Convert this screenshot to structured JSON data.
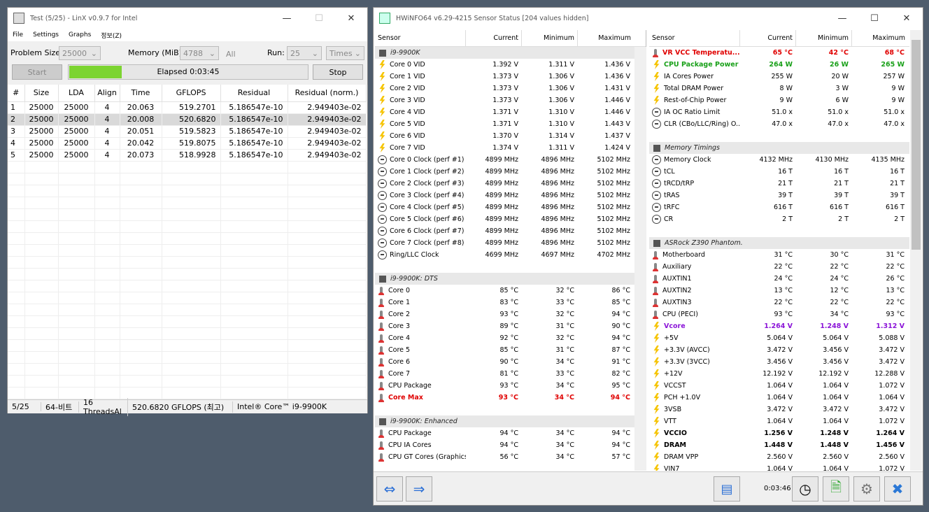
{
  "linx": {
    "title": "Test (5/25) - LinX v0.9.7 for Intel",
    "menu": [
      "File",
      "Settings",
      "Graphs",
      "정보(Z)"
    ],
    "problem_size_label": "Problem Size:",
    "problem_size": "25000",
    "memory_label": "Memory (MiB):",
    "memory": "4788",
    "all_label": "All",
    "run_label": "Run:",
    "run": "25",
    "run_mode": "Times",
    "start": "Start",
    "stop": "Stop",
    "elapsed": "Elapsed 0:03:45",
    "progress": 0.22,
    "columns": [
      "#",
      "Size",
      "LDA",
      "Align",
      "Time",
      "GFLOPS",
      "Residual",
      "Residual (norm.)"
    ],
    "rows": [
      [
        "1",
        "25000",
        "25000",
        "4",
        "20.063",
        "519.2701",
        "5.186547e-10",
        "2.949403e-02"
      ],
      [
        "2",
        "25000",
        "25000",
        "4",
        "20.008",
        "520.6820",
        "5.186547e-10",
        "2.949403e-02"
      ],
      [
        "3",
        "25000",
        "25000",
        "4",
        "20.051",
        "519.5823",
        "5.186547e-10",
        "2.949403e-02"
      ],
      [
        "4",
        "25000",
        "25000",
        "4",
        "20.042",
        "519.8075",
        "5.186547e-10",
        "2.949403e-02"
      ],
      [
        "5",
        "25000",
        "25000",
        "4",
        "20.073",
        "518.9928",
        "5.186547e-10",
        "2.949403e-02"
      ]
    ],
    "status": [
      "5/25",
      "64-비트",
      "16 ThreadsAl",
      "520.6820 GFLOPS (최고)",
      "Intel® Core™ i9-9900K"
    ]
  },
  "hwinfo": {
    "title": "HWiNFO64 v6.29-4215 Sensor Status [204 values hidden]",
    "columns": [
      "Sensor",
      "Current",
      "Minimum",
      "Maximum"
    ],
    "left": [
      {
        "g": "i9-9900K"
      },
      {
        "i": "volt",
        "n": "Core 0 VID",
        "c": "1.392 V",
        "mi": "1.311 V",
        "ma": "1.436 V"
      },
      {
        "i": "volt",
        "n": "Core 1 VID",
        "c": "1.373 V",
        "mi": "1.306 V",
        "ma": "1.436 V"
      },
      {
        "i": "volt",
        "n": "Core 2 VID",
        "c": "1.373 V",
        "mi": "1.306 V",
        "ma": "1.431 V"
      },
      {
        "i": "volt",
        "n": "Core 3 VID",
        "c": "1.373 V",
        "mi": "1.306 V",
        "ma": "1.446 V"
      },
      {
        "i": "volt",
        "n": "Core 4 VID",
        "c": "1.371 V",
        "mi": "1.310 V",
        "ma": "1.446 V"
      },
      {
        "i": "volt",
        "n": "Core 5 VID",
        "c": "1.371 V",
        "mi": "1.310 V",
        "ma": "1.443 V"
      },
      {
        "i": "volt",
        "n": "Core 6 VID",
        "c": "1.370 V",
        "mi": "1.314 V",
        "ma": "1.437 V"
      },
      {
        "i": "volt",
        "n": "Core 7 VID",
        "c": "1.374 V",
        "mi": "1.311 V",
        "ma": "1.424 V"
      },
      {
        "i": "clock",
        "n": "Core 0 Clock (perf #1)",
        "c": "4899 MHz",
        "mi": "4896 MHz",
        "ma": "5102 MHz"
      },
      {
        "i": "clock",
        "n": "Core 1 Clock (perf #2)",
        "c": "4899 MHz",
        "mi": "4896 MHz",
        "ma": "5102 MHz"
      },
      {
        "i": "clock",
        "n": "Core 2 Clock (perf #3)",
        "c": "4899 MHz",
        "mi": "4896 MHz",
        "ma": "5102 MHz"
      },
      {
        "i": "clock",
        "n": "Core 3 Clock (perf #4)",
        "c": "4899 MHz",
        "mi": "4896 MHz",
        "ma": "5102 MHz"
      },
      {
        "i": "clock",
        "n": "Core 4 Clock (perf #5)",
        "c": "4899 MHz",
        "mi": "4896 MHz",
        "ma": "5102 MHz"
      },
      {
        "i": "clock",
        "n": "Core 5 Clock (perf #6)",
        "c": "4899 MHz",
        "mi": "4896 MHz",
        "ma": "5102 MHz"
      },
      {
        "i": "clock",
        "n": "Core 6 Clock (perf #7)",
        "c": "4899 MHz",
        "mi": "4896 MHz",
        "ma": "5102 MHz"
      },
      {
        "i": "clock",
        "n": "Core 7 Clock (perf #8)",
        "c": "4899 MHz",
        "mi": "4896 MHz",
        "ma": "5102 MHz"
      },
      {
        "i": "clock",
        "n": "Ring/LLC Clock",
        "c": "4699 MHz",
        "mi": "4697 MHz",
        "ma": "4702 MHz"
      },
      {
        "blank": true
      },
      {
        "g": "i9-9900K: DTS"
      },
      {
        "i": "therm",
        "n": "Core 0",
        "c": "85 °C",
        "mi": "32 °C",
        "ma": "86 °C"
      },
      {
        "i": "therm",
        "n": "Core 1",
        "c": "83 °C",
        "mi": "33 °C",
        "ma": "85 °C"
      },
      {
        "i": "therm",
        "n": "Core 2",
        "c": "93 °C",
        "mi": "32 °C",
        "ma": "94 °C"
      },
      {
        "i": "therm",
        "n": "Core 3",
        "c": "89 °C",
        "mi": "31 °C",
        "ma": "90 °C"
      },
      {
        "i": "therm",
        "n": "Core 4",
        "c": "92 °C",
        "mi": "32 °C",
        "ma": "94 °C"
      },
      {
        "i": "therm",
        "n": "Core 5",
        "c": "85 °C",
        "mi": "31 °C",
        "ma": "87 °C"
      },
      {
        "i": "therm",
        "n": "Core 6",
        "c": "90 °C",
        "mi": "34 °C",
        "ma": "91 °C"
      },
      {
        "i": "therm",
        "n": "Core 7",
        "c": "81 °C",
        "mi": "33 °C",
        "ma": "82 °C"
      },
      {
        "i": "therm",
        "n": "CPU Package",
        "c": "93 °C",
        "mi": "34 °C",
        "ma": "95 °C"
      },
      {
        "i": "therm",
        "n": "Core Max",
        "c": "93 °C",
        "mi": "34 °C",
        "ma": "94 °C",
        "s": "red"
      },
      {
        "blank": true
      },
      {
        "g": "i9-9900K: Enhanced"
      },
      {
        "i": "therm",
        "n": "CPU Package",
        "c": "94 °C",
        "mi": "34 °C",
        "ma": "94 °C"
      },
      {
        "i": "therm",
        "n": "CPU IA Cores",
        "c": "94 °C",
        "mi": "34 °C",
        "ma": "94 °C"
      },
      {
        "i": "therm",
        "n": "CPU GT Cores (Graphics)",
        "c": "56 °C",
        "mi": "34 °C",
        "ma": "57 °C"
      }
    ],
    "right": [
      {
        "i": "therm",
        "n": "VR VCC Temperatu...",
        "c": "65 °C",
        "mi": "42 °C",
        "ma": "68 °C",
        "s": "red"
      },
      {
        "i": "volt",
        "n": "CPU Package Power",
        "c": "264 W",
        "mi": "26 W",
        "ma": "265 W",
        "s": "green"
      },
      {
        "i": "volt",
        "n": "IA Cores Power",
        "c": "255 W",
        "mi": "20 W",
        "ma": "257 W"
      },
      {
        "i": "volt",
        "n": "Total DRAM Power",
        "c": "8 W",
        "mi": "3 W",
        "ma": "9 W"
      },
      {
        "i": "volt",
        "n": "Rest-of-Chip Power",
        "c": "9 W",
        "mi": "6 W",
        "ma": "9 W"
      },
      {
        "i": "clock",
        "n": "IA OC Ratio Limit",
        "c": "51.0 x",
        "mi": "51.0 x",
        "ma": "51.0 x"
      },
      {
        "i": "clock",
        "n": "CLR (CBo/LLC/Ring) O...",
        "c": "47.0 x",
        "mi": "47.0 x",
        "ma": "47.0 x"
      },
      {
        "blank": true
      },
      {
        "g": "Memory Timings"
      },
      {
        "i": "clock",
        "n": "Memory Clock",
        "c": "4132 MHz",
        "mi": "4130 MHz",
        "ma": "4135 MHz"
      },
      {
        "i": "clock",
        "n": "tCL",
        "c": "16 T",
        "mi": "16 T",
        "ma": "16 T"
      },
      {
        "i": "clock",
        "n": "tRCD/tRP",
        "c": "21 T",
        "mi": "21 T",
        "ma": "21 T"
      },
      {
        "i": "clock",
        "n": "tRAS",
        "c": "39 T",
        "mi": "39 T",
        "ma": "39 T"
      },
      {
        "i": "clock",
        "n": "tRFC",
        "c": "616 T",
        "mi": "616 T",
        "ma": "616 T"
      },
      {
        "i": "clock",
        "n": "CR",
        "c": "2 T",
        "mi": "2 T",
        "ma": "2 T"
      },
      {
        "blank": true
      },
      {
        "g": "ASRock Z390 Phantom..."
      },
      {
        "i": "therm",
        "n": "Motherboard",
        "c": "31 °C",
        "mi": "30 °C",
        "ma": "31 °C"
      },
      {
        "i": "therm",
        "n": "Auxiliary",
        "c": "22 °C",
        "mi": "22 °C",
        "ma": "22 °C"
      },
      {
        "i": "therm",
        "n": "AUXTIN1",
        "c": "24 °C",
        "mi": "24 °C",
        "ma": "26 °C"
      },
      {
        "i": "therm",
        "n": "AUXTIN2",
        "c": "13 °C",
        "mi": "12 °C",
        "ma": "13 °C"
      },
      {
        "i": "therm",
        "n": "AUXTIN3",
        "c": "22 °C",
        "mi": "22 °C",
        "ma": "22 °C"
      },
      {
        "i": "therm",
        "n": "CPU (PECI)",
        "c": "93 °C",
        "mi": "34 °C",
        "ma": "93 °C"
      },
      {
        "i": "volt",
        "n": "Vcore",
        "c": "1.264 V",
        "mi": "1.248 V",
        "ma": "1.312 V",
        "s": "purple"
      },
      {
        "i": "volt",
        "n": "+5V",
        "c": "5.064 V",
        "mi": "5.064 V",
        "ma": "5.088 V"
      },
      {
        "i": "volt",
        "n": "+3.3V (AVCC)",
        "c": "3.472 V",
        "mi": "3.456 V",
        "ma": "3.472 V"
      },
      {
        "i": "volt",
        "n": "+3.3V (3VCC)",
        "c": "3.456 V",
        "mi": "3.456 V",
        "ma": "3.472 V"
      },
      {
        "i": "volt",
        "n": "+12V",
        "c": "12.192 V",
        "mi": "12.192 V",
        "ma": "12.288 V"
      },
      {
        "i": "volt",
        "n": "VCCST",
        "c": "1.064 V",
        "mi": "1.064 V",
        "ma": "1.072 V"
      },
      {
        "i": "volt",
        "n": "PCH +1.0V",
        "c": "1.064 V",
        "mi": "1.064 V",
        "ma": "1.064 V"
      },
      {
        "i": "volt",
        "n": "3VSB",
        "c": "3.472 V",
        "mi": "3.472 V",
        "ma": "3.472 V"
      },
      {
        "i": "volt",
        "n": "VTT",
        "c": "1.064 V",
        "mi": "1.064 V",
        "ma": "1.072 V"
      },
      {
        "i": "volt",
        "n": "VCCIO",
        "c": "1.256 V",
        "mi": "1.248 V",
        "ma": "1.264 V",
        "s": "bold"
      },
      {
        "i": "volt",
        "n": "DRAM",
        "c": "1.448 V",
        "mi": "1.448 V",
        "ma": "1.456 V",
        "s": "bold"
      },
      {
        "i": "volt",
        "n": "DRAM VPP",
        "c": "2.560 V",
        "mi": "2.560 V",
        "ma": "2.560 V"
      },
      {
        "i": "volt",
        "n": "VIN7",
        "c": "1.064 V",
        "mi": "1.064 V",
        "ma": "1.072 V"
      }
    ],
    "timer": "0:03:46",
    "footer_icons": [
      "navigate-left-icon",
      "navigate-right-icon",
      "network-icon",
      "clock-icon",
      "report-icon",
      "settings-icon",
      "close-icon"
    ]
  }
}
